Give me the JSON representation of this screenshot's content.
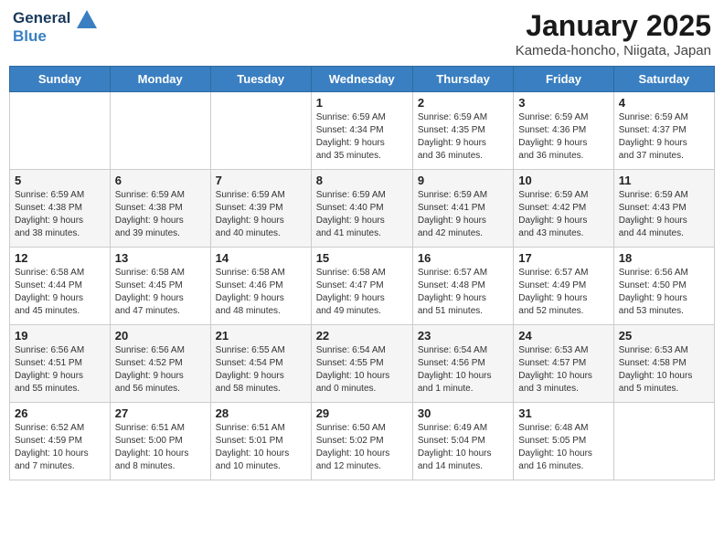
{
  "header": {
    "logo_line1": "General",
    "logo_line2": "Blue",
    "month": "January 2025",
    "location": "Kameda-honcho, Niigata, Japan"
  },
  "weekdays": [
    "Sunday",
    "Monday",
    "Tuesday",
    "Wednesday",
    "Thursday",
    "Friday",
    "Saturday"
  ],
  "weeks": [
    [
      {
        "day": "",
        "info": ""
      },
      {
        "day": "",
        "info": ""
      },
      {
        "day": "",
        "info": ""
      },
      {
        "day": "1",
        "info": "Sunrise: 6:59 AM\nSunset: 4:34 PM\nDaylight: 9 hours\nand 35 minutes."
      },
      {
        "day": "2",
        "info": "Sunrise: 6:59 AM\nSunset: 4:35 PM\nDaylight: 9 hours\nand 36 minutes."
      },
      {
        "day": "3",
        "info": "Sunrise: 6:59 AM\nSunset: 4:36 PM\nDaylight: 9 hours\nand 36 minutes."
      },
      {
        "day": "4",
        "info": "Sunrise: 6:59 AM\nSunset: 4:37 PM\nDaylight: 9 hours\nand 37 minutes."
      }
    ],
    [
      {
        "day": "5",
        "info": "Sunrise: 6:59 AM\nSunset: 4:38 PM\nDaylight: 9 hours\nand 38 minutes."
      },
      {
        "day": "6",
        "info": "Sunrise: 6:59 AM\nSunset: 4:38 PM\nDaylight: 9 hours\nand 39 minutes."
      },
      {
        "day": "7",
        "info": "Sunrise: 6:59 AM\nSunset: 4:39 PM\nDaylight: 9 hours\nand 40 minutes."
      },
      {
        "day": "8",
        "info": "Sunrise: 6:59 AM\nSunset: 4:40 PM\nDaylight: 9 hours\nand 41 minutes."
      },
      {
        "day": "9",
        "info": "Sunrise: 6:59 AM\nSunset: 4:41 PM\nDaylight: 9 hours\nand 42 minutes."
      },
      {
        "day": "10",
        "info": "Sunrise: 6:59 AM\nSunset: 4:42 PM\nDaylight: 9 hours\nand 43 minutes."
      },
      {
        "day": "11",
        "info": "Sunrise: 6:59 AM\nSunset: 4:43 PM\nDaylight: 9 hours\nand 44 minutes."
      }
    ],
    [
      {
        "day": "12",
        "info": "Sunrise: 6:58 AM\nSunset: 4:44 PM\nDaylight: 9 hours\nand 45 minutes."
      },
      {
        "day": "13",
        "info": "Sunrise: 6:58 AM\nSunset: 4:45 PM\nDaylight: 9 hours\nand 47 minutes."
      },
      {
        "day": "14",
        "info": "Sunrise: 6:58 AM\nSunset: 4:46 PM\nDaylight: 9 hours\nand 48 minutes."
      },
      {
        "day": "15",
        "info": "Sunrise: 6:58 AM\nSunset: 4:47 PM\nDaylight: 9 hours\nand 49 minutes."
      },
      {
        "day": "16",
        "info": "Sunrise: 6:57 AM\nSunset: 4:48 PM\nDaylight: 9 hours\nand 51 minutes."
      },
      {
        "day": "17",
        "info": "Sunrise: 6:57 AM\nSunset: 4:49 PM\nDaylight: 9 hours\nand 52 minutes."
      },
      {
        "day": "18",
        "info": "Sunrise: 6:56 AM\nSunset: 4:50 PM\nDaylight: 9 hours\nand 53 minutes."
      }
    ],
    [
      {
        "day": "19",
        "info": "Sunrise: 6:56 AM\nSunset: 4:51 PM\nDaylight: 9 hours\nand 55 minutes."
      },
      {
        "day": "20",
        "info": "Sunrise: 6:56 AM\nSunset: 4:52 PM\nDaylight: 9 hours\nand 56 minutes."
      },
      {
        "day": "21",
        "info": "Sunrise: 6:55 AM\nSunset: 4:54 PM\nDaylight: 9 hours\nand 58 minutes."
      },
      {
        "day": "22",
        "info": "Sunrise: 6:54 AM\nSunset: 4:55 PM\nDaylight: 10 hours\nand 0 minutes."
      },
      {
        "day": "23",
        "info": "Sunrise: 6:54 AM\nSunset: 4:56 PM\nDaylight: 10 hours\nand 1 minute."
      },
      {
        "day": "24",
        "info": "Sunrise: 6:53 AM\nSunset: 4:57 PM\nDaylight: 10 hours\nand 3 minutes."
      },
      {
        "day": "25",
        "info": "Sunrise: 6:53 AM\nSunset: 4:58 PM\nDaylight: 10 hours\nand 5 minutes."
      }
    ],
    [
      {
        "day": "26",
        "info": "Sunrise: 6:52 AM\nSunset: 4:59 PM\nDaylight: 10 hours\nand 7 minutes."
      },
      {
        "day": "27",
        "info": "Sunrise: 6:51 AM\nSunset: 5:00 PM\nDaylight: 10 hours\nand 8 minutes."
      },
      {
        "day": "28",
        "info": "Sunrise: 6:51 AM\nSunset: 5:01 PM\nDaylight: 10 hours\nand 10 minutes."
      },
      {
        "day": "29",
        "info": "Sunrise: 6:50 AM\nSunset: 5:02 PM\nDaylight: 10 hours\nand 12 minutes."
      },
      {
        "day": "30",
        "info": "Sunrise: 6:49 AM\nSunset: 5:04 PM\nDaylight: 10 hours\nand 14 minutes."
      },
      {
        "day": "31",
        "info": "Sunrise: 6:48 AM\nSunset: 5:05 PM\nDaylight: 10 hours\nand 16 minutes."
      },
      {
        "day": "",
        "info": ""
      }
    ]
  ]
}
